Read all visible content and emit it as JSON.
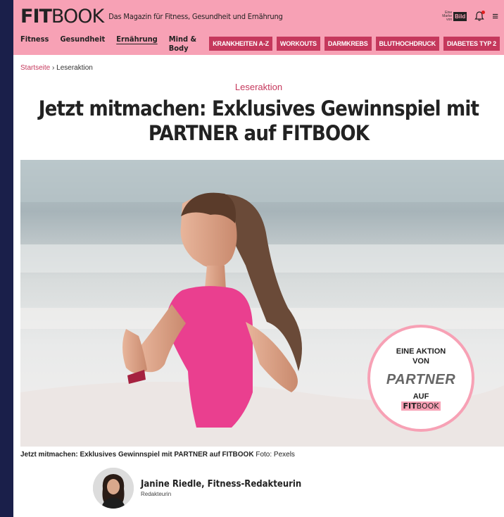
{
  "header": {
    "logo_fit": "FIT",
    "logo_book": "BOOK",
    "tagline": "Das Magazin für Fitness, Gesundheit und Ernährung",
    "bild_small": "Eine Marke von",
    "bild_logo": "Bild"
  },
  "nav": {
    "items": [
      {
        "label": "Fitness"
      },
      {
        "label": "Gesundheit"
      },
      {
        "label": "Ernährung"
      },
      {
        "label": "Mind & Body"
      }
    ],
    "pills": [
      {
        "label": "KRANKHEITEN A-Z"
      },
      {
        "label": "WORKOUTS"
      },
      {
        "label": "DARMKREBS"
      },
      {
        "label": "BLUTHOCHDRUCK"
      },
      {
        "label": "DIABETES TYP 2"
      }
    ]
  },
  "breadcrumb": {
    "home": "Startseite",
    "separator": "›",
    "current": "Leseraktion"
  },
  "article": {
    "kicker": "Leseraktion",
    "headline": "Jetzt mitmachen: Exklusives Gewinnspiel mit PARTNER auf FITBOOK",
    "badge": {
      "line1": "EINE AKTION VON",
      "partner": "PARTNER",
      "auf": "AUF",
      "logo_fit": "FIT",
      "logo_book": "BOOK"
    },
    "caption_bold": "Jetzt mitmachen: Exklusives Gewinnspiel mit PARTNER auf FITBOOK",
    "caption_credit": "Foto: Pexels",
    "author_name": "Janine Riedle, Fitness-Redakteurin",
    "author_role": "Redakteurin"
  },
  "colors": {
    "brand_pink": "#f7a1b5",
    "accent": "#c5385c",
    "outer_bg": "#1a1f4a"
  }
}
